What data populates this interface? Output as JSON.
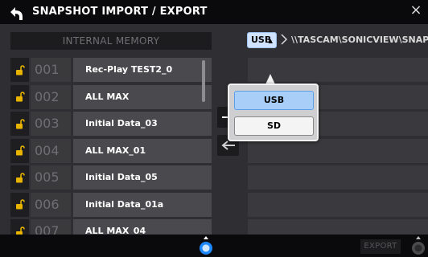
{
  "window": {
    "title": "SNAPSHOT IMPORT / EXPORT",
    "close_glyph": "×"
  },
  "internal_memory": {
    "header": "INTERNAL MEMORY",
    "rows": [
      {
        "number": "001",
        "name": "Rec-Play TEST2_0",
        "lock_icon": "unlocked-padlock-icon"
      },
      {
        "number": "002",
        "name": "ALL MAX",
        "lock_icon": "unlocked-padlock-icon"
      },
      {
        "number": "003",
        "name": "Initial Data_03",
        "lock_icon": "unlocked-padlock-icon"
      },
      {
        "number": "004",
        "name": "ALL MAX_01",
        "lock_icon": "unlocked-padlock-icon"
      },
      {
        "number": "005",
        "name": "Initial Data_05",
        "lock_icon": "unlocked-padlock-icon"
      },
      {
        "number": "006",
        "name": "Initial Data_01a",
        "lock_icon": "unlocked-padlock-icon"
      },
      {
        "number": "007",
        "name": "ALL MAX_04",
        "lock_icon": "unlocked-padlock-icon"
      }
    ]
  },
  "external": {
    "drive_selected": "USB",
    "path": "\\\\TASCAM\\SONICVIEW\\SNAPSHOT\\",
    "drive_options": [
      "USB",
      "SD"
    ],
    "drive_option_selected": "USB"
  },
  "transfer": {
    "export_icon": "arrow-right-icon",
    "import_icon": "arrow-left-icon"
  },
  "footer": {
    "export_label": "EXPORT"
  },
  "colors": {
    "accent_blue": "#a9cff9",
    "lock_yellow": "#e8b400",
    "knob_blue": "#1e88ff"
  }
}
